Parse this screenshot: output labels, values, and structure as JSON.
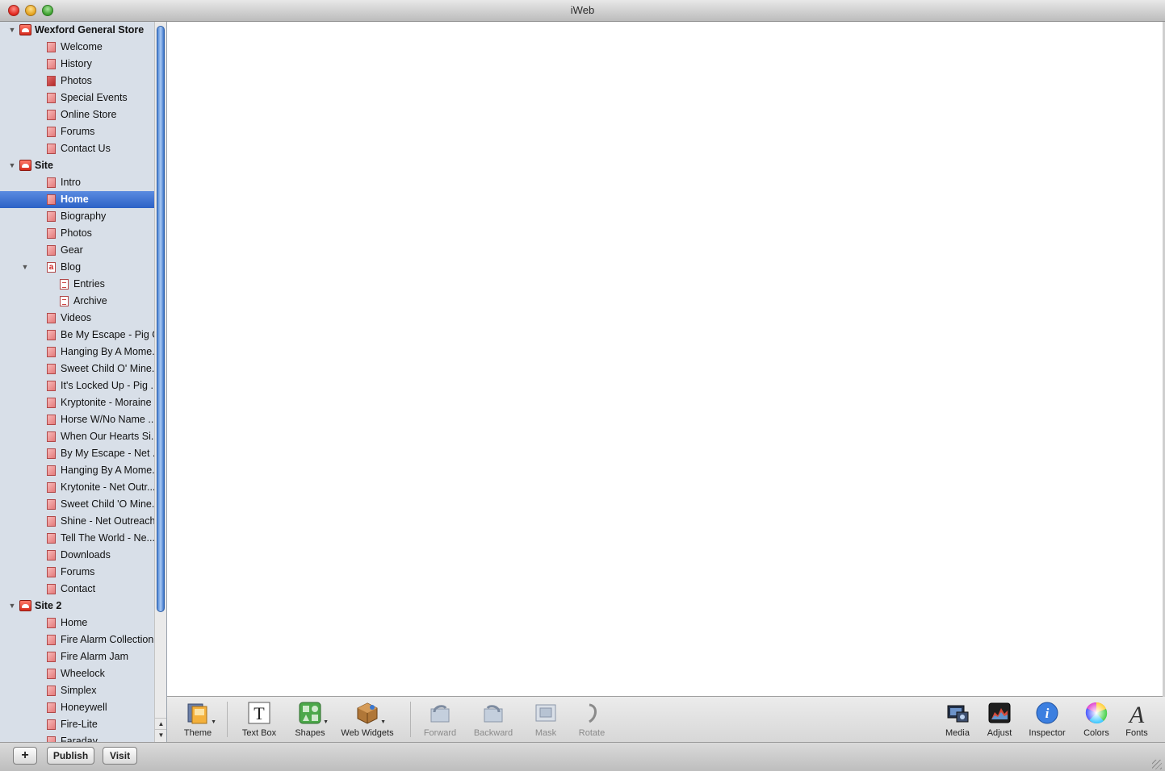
{
  "window": {
    "title": "iWeb"
  },
  "sidebar": {
    "selected_index": 11,
    "items": [
      {
        "label": "Wexford General Store",
        "type": "site",
        "level": 0,
        "expanded": true
      },
      {
        "label": "Welcome",
        "type": "page",
        "level": 1
      },
      {
        "label": "History",
        "type": "page",
        "level": 1
      },
      {
        "label": "Photos",
        "type": "photos",
        "level": 1
      },
      {
        "label": "Special Events",
        "type": "page",
        "level": 1
      },
      {
        "label": "Online Store",
        "type": "page",
        "level": 1
      },
      {
        "label": "Forums",
        "type": "page",
        "level": 1
      },
      {
        "label": "Contact Us",
        "type": "page",
        "level": 1
      },
      {
        "label": "Site",
        "type": "site",
        "level": 0,
        "expanded": true
      },
      {
        "label": "Intro",
        "type": "page",
        "level": 1
      },
      {
        "label": "Home",
        "type": "page",
        "level": 1
      },
      {
        "label": "Biography",
        "type": "page",
        "level": 1
      },
      {
        "label": "Photos",
        "type": "page",
        "level": 1
      },
      {
        "label": "Gear",
        "type": "page",
        "level": 1
      },
      {
        "label": "Blog",
        "type": "blog",
        "level": 1,
        "expanded": true
      },
      {
        "label": "Entries",
        "type": "doc",
        "level": 2
      },
      {
        "label": "Archive",
        "type": "doc",
        "level": 2
      },
      {
        "label": "Videos",
        "type": "page",
        "level": 1
      },
      {
        "label": "Be My Escape - Pig Gig",
        "type": "page",
        "level": 1
      },
      {
        "label": "Hanging By A Mome...",
        "type": "page",
        "level": 1
      },
      {
        "label": "Sweet Child O' Mine...",
        "type": "page",
        "level": 1
      },
      {
        "label": "It's Locked Up - Pig ...",
        "type": "page",
        "level": 1
      },
      {
        "label": "Kryptonite - Moraine",
        "type": "page",
        "level": 1
      },
      {
        "label": "Horse W/No Name ...",
        "type": "page",
        "level": 1
      },
      {
        "label": "When Our Hearts Si...",
        "type": "page",
        "level": 1
      },
      {
        "label": "By My Escape - Net ...",
        "type": "page",
        "level": 1
      },
      {
        "label": "Hanging By A Mome...",
        "type": "page",
        "level": 1
      },
      {
        "label": "Krytonite - Net Outr...",
        "type": "page",
        "level": 1
      },
      {
        "label": "Sweet Child 'O Mine...",
        "type": "page",
        "level": 1
      },
      {
        "label": "Shine - Net Outreach",
        "type": "page",
        "level": 1
      },
      {
        "label": "Tell The World - Ne...",
        "type": "page",
        "level": 1
      },
      {
        "label": "Downloads",
        "type": "page",
        "level": 1
      },
      {
        "label": "Forums",
        "type": "page",
        "level": 1
      },
      {
        "label": "Contact",
        "type": "page",
        "level": 1
      },
      {
        "label": "Site 2",
        "type": "site",
        "level": 0,
        "expanded": true
      },
      {
        "label": "Home",
        "type": "page",
        "level": 1
      },
      {
        "label": "Fire Alarm Collection",
        "type": "page",
        "level": 1
      },
      {
        "label": "Fire Alarm Jam",
        "type": "page",
        "level": 1
      },
      {
        "label": "Wheelock",
        "type": "page",
        "level": 1
      },
      {
        "label": "Simplex",
        "type": "page",
        "level": 1
      },
      {
        "label": "Honeywell",
        "type": "page",
        "level": 1
      },
      {
        "label": "Fire-Lite",
        "type": "page",
        "level": 1
      },
      {
        "label": "Faraday",
        "type": "page",
        "level": 1
      }
    ]
  },
  "toolbar": {
    "theme": "Theme",
    "text_box": "Text Box",
    "shapes": "Shapes",
    "web_widgets": "Web Widgets",
    "forward": "Forward",
    "backward": "Backward",
    "mask": "Mask",
    "rotate": "Rotate",
    "media": "Media",
    "adjust": "Adjust",
    "inspector": "Inspector",
    "colors": "Colors",
    "fonts": "Fonts",
    "text_box_glyph": "T",
    "inspector_glyph": "i",
    "fonts_glyph": "A"
  },
  "bottombar": {
    "add_label": "+",
    "publish_label": "Publish",
    "visit_label": "Visit"
  }
}
